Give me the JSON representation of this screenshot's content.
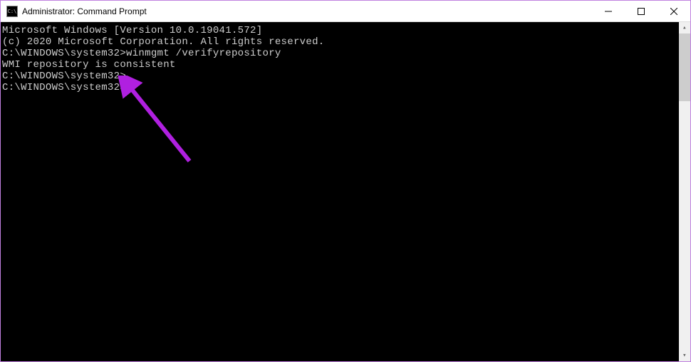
{
  "window": {
    "title": "Administrator: Command Prompt",
    "icon_glyph": "C:\\"
  },
  "terminal": {
    "lines": [
      "Microsoft Windows [Version 10.0.19041.572]",
      "(c) 2020 Microsoft Corporation. All rights reserved.",
      "",
      "C:\\WINDOWS\\system32>winmgmt /verifyrepository",
      "WMI repository is consistent",
      "",
      "C:\\WINDOWS\\system32>",
      "C:\\WINDOWS\\system32>"
    ]
  },
  "annotation": {
    "arrow_color": "#b020e0"
  }
}
